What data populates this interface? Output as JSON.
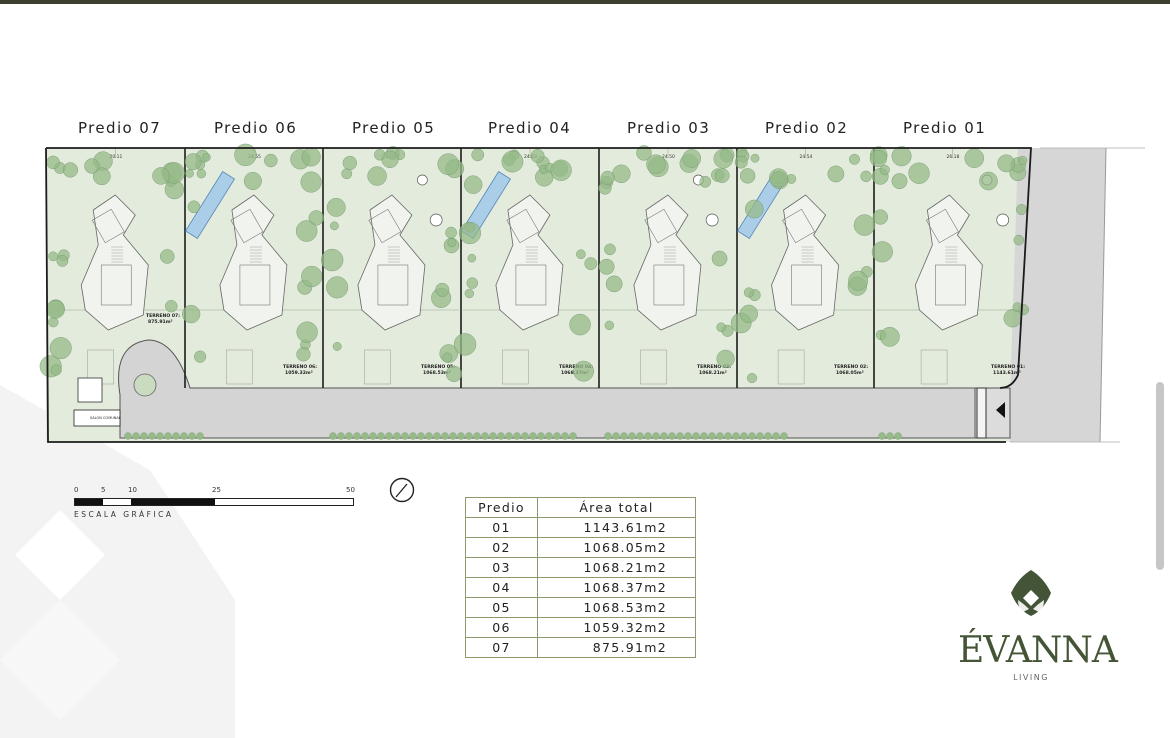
{
  "lot_labels": [
    "Predio 07",
    "Predio 06",
    "Predio 05",
    "Predio 04",
    "Predio 03",
    "Predio 02",
    "Predio 01"
  ],
  "lot_dimensions": [
    "20.11",
    "24.55",
    "24.63",
    "24.63",
    "24.50",
    "24.54",
    "26.18"
  ],
  "terrenos": [
    {
      "name": "TERRENO 07:",
      "area": "875.91m²"
    },
    {
      "name": "TERRENO 06:",
      "area": "1059.32m²"
    },
    {
      "name": "TERRENO 05:",
      "area": "1068.53m²"
    },
    {
      "name": "TERRENO 04:",
      "area": "1068.37m²"
    },
    {
      "name": "TERRENO 03:",
      "area": "1068.21m²"
    },
    {
      "name": "TERRENO 02:",
      "area": "1068.05m²"
    },
    {
      "name": "TERRENO 01:",
      "area": "1143.61m²"
    }
  ],
  "salon_label": "SALON COMUNAL",
  "scale": {
    "ticks": [
      "0",
      "5",
      "10",
      "25",
      "50"
    ],
    "caption": "ESCALA GRÁFICA"
  },
  "table": {
    "headers": [
      "Predio",
      "Área total"
    ],
    "rows": [
      [
        "01",
        "1143.61m2"
      ],
      [
        "02",
        "1068.05m2"
      ],
      [
        "03",
        "1068.21m2"
      ],
      [
        "04",
        "1068.37m2"
      ],
      [
        "05",
        "1068.53m2"
      ],
      [
        "06",
        "1059.32m2"
      ],
      [
        "07",
        "875.91m2"
      ]
    ]
  },
  "brand": {
    "name": "ÉVANNA",
    "tagline": "LIVING"
  },
  "colors": {
    "lawn": "#e3ebdc",
    "tree": "#95ba88",
    "road": "#d4d4d4",
    "brand": "#445537",
    "border": "#1c1c1c"
  }
}
